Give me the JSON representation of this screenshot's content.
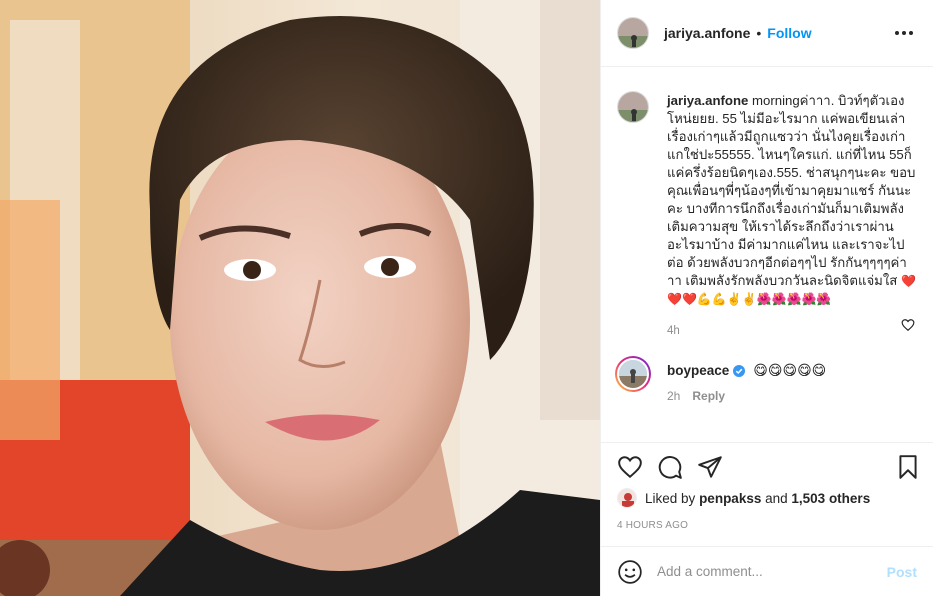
{
  "post": {
    "author": "jariya.anfone",
    "follow_label": "Follow",
    "separator": "•",
    "photo_alt": "Selfie of a woman with short dark hair"
  },
  "caption": {
    "username": "jariya.anfone",
    "text": "morningค่าาา. บิวท์ๆตัวเองโหน่ยยย. 55 ไม่มีอะไรมาก แค่พอเขียนเล่าเรื่องเก่าๆแล้วมีถูกแซวว่า นั่นไงคุยเรื่องเก่า แกใช่ปะ55555. ไหนๆใครแก่. แก่ที่ไหน 55ก็แค่ครึ่งร้อยนิดๆเอง.555. ช่าสนุกๆนะคะ ขอบคุณเพื่อนๆพี่ๆน้องๆที่เข้ามาคุยมาแชร์ กันนะคะ บางทีการนึกถึงเรื่องเก่ามันก็มาเติมพลัง เติมความสุข ให้เราได้ระลึกถึงว่าเราผ่านอะไรมาบ้าง มีค่ามากแค่ไหน และเราจะไปต่อ ด้วยพลังบวกๆอีกต่อๆๆไป รักกันๆๆๆๆค่าาา เติมพลังรักพลังบวกวันละนิดจิตแจ่มใส",
    "emojis": "❤️❤️❤️💪💪✌️✌️🌺🌺🌺🌺🌺",
    "time": "4h"
  },
  "comment": {
    "username": "boypeace",
    "text": "😋😋😋😋😋",
    "time": "2h",
    "reply_label": "Reply"
  },
  "likes": {
    "prefix": "Liked by",
    "user": "penpakss",
    "and": "and",
    "count": "1,503 others"
  },
  "post_time": "4 HOURS AGO",
  "add_comment": {
    "placeholder": "Add a comment...",
    "post_label": "Post"
  },
  "icons": {
    "more": "more-options-icon",
    "like": "heart-icon",
    "comment": "comment-bubble-icon",
    "share": "paper-plane-icon",
    "save": "bookmark-icon",
    "emoji": "smiley-icon",
    "verified": "verified-badge-icon"
  },
  "colors": {
    "link": "#0095f6",
    "muted": "#8e8e8e",
    "post_disabled": "#b2dffc",
    "verified": "#3897f0"
  }
}
